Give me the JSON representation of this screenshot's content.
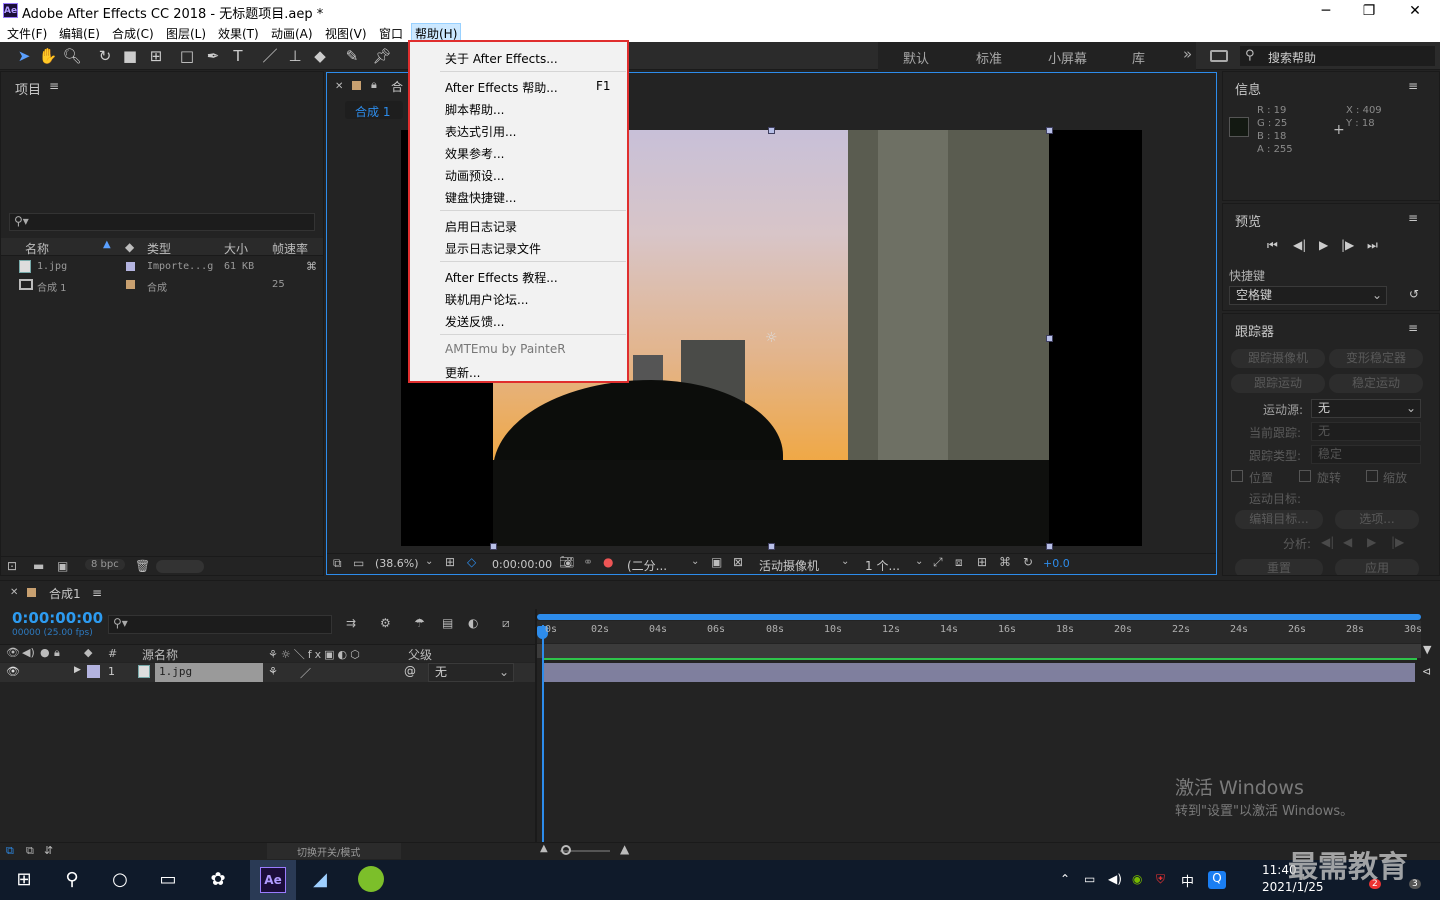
{
  "window": {
    "title": "Adobe After Effects CC 2018 - 无标题项目.aep *",
    "app_badge": "Ae",
    "minimize": "─",
    "maximize": "❐",
    "close": "✕"
  },
  "menubar": {
    "items": [
      "文件(F)",
      "编辑(E)",
      "合成(C)",
      "图层(L)",
      "效果(T)",
      "动画(A)",
      "视图(V)",
      "窗口",
      "帮助(H)"
    ]
  },
  "workspaces": {
    "items": [
      "默认",
      "标准",
      "小屏幕",
      "库"
    ],
    "more": "»",
    "search_placeholder": "搜索帮助"
  },
  "help_menu": {
    "items": [
      {
        "label": "关于 After Effects...",
        "shortcut": ""
      },
      {
        "label": "After Effects 帮助...",
        "shortcut": "F1"
      },
      {
        "label": "脚本帮助...",
        "shortcut": ""
      },
      {
        "label": "表达式引用...",
        "shortcut": ""
      },
      {
        "label": "效果参考...",
        "shortcut": ""
      },
      {
        "label": "动画预设...",
        "shortcut": ""
      },
      {
        "label": "键盘快捷键...",
        "shortcut": ""
      },
      {
        "label": "启用日志记录",
        "shortcut": ""
      },
      {
        "label": "显示日志记录文件",
        "shortcut": ""
      },
      {
        "label": "After Effects 教程...",
        "shortcut": ""
      },
      {
        "label": "联机用户论坛...",
        "shortcut": ""
      },
      {
        "label": "发送反馈...",
        "shortcut": ""
      },
      {
        "label": "AMTEmu by PainteR",
        "shortcut": ""
      },
      {
        "label": "更新...",
        "shortcut": ""
      }
    ]
  },
  "project_panel": {
    "title": "项目",
    "search_placeholder": "",
    "columns": [
      "名称",
      "类型",
      "大小",
      "帧速率"
    ],
    "rows": [
      {
        "name": "1.jpg",
        "type": "Importe...g",
        "size": "61 KB",
        "fps": ""
      },
      {
        "name": "合成 1",
        "type": "合成",
        "size": "",
        "fps": "25"
      }
    ],
    "bpc": "8 bpc"
  },
  "comp_viewer": {
    "tab_label": "合成 1",
    "tab_title": "合",
    "zoom": "(38.6%)",
    "timecode": "0:00:00:00",
    "resolution": "(二分...",
    "camera": "活动摄像机",
    "views": "1 个...",
    "exposure": "+0.0"
  },
  "info_panel": {
    "title": "信息",
    "r": "R : 19",
    "g": "G : 25",
    "b": "B : 18",
    "a": "A : 255",
    "x": "X : 409",
    "y": "Y : 18",
    "swatch_color": "#131912"
  },
  "preview_panel": {
    "title": "预览",
    "shortcut_label": "快捷键",
    "shortcut_value": "空格键"
  },
  "tracker_panel": {
    "title": "跟踪器",
    "btn_track_camera": "跟踪摄像机",
    "btn_warp": "变形稳定器",
    "btn_track_motion": "跟踪运动",
    "btn_stabilize": "稳定运动",
    "motion_source_label": "运动源:",
    "motion_source_value": "无",
    "current_track_label": "当前跟踪:",
    "current_track_value": "无",
    "track_type_label": "跟踪类型:",
    "track_type_value": "稳定",
    "cb_position": "位置",
    "cb_rotation": "旋转",
    "cb_scale": "缩放",
    "motion_target_label": "运动目标:",
    "edit_target": "编辑目标...",
    "options": "选项...",
    "analyze_label": "分析:",
    "reset": "重置",
    "apply": "应用"
  },
  "timeline": {
    "comp_tab": "合成1",
    "timecode": "0:00:00:00",
    "fps_info": "00000 (25.00 fps)",
    "col_num": "#",
    "col_source": "源名称",
    "col_parent": "父级",
    "layer": {
      "index": "1",
      "name": "1.jpg",
      "parent": "无"
    },
    "ticks": [
      "0s",
      "02s",
      "04s",
      "06s",
      "08s",
      "10s",
      "12s",
      "14s",
      "16s",
      "18s",
      "20s",
      "22s",
      "24s",
      "26s",
      "28s",
      "30s"
    ],
    "toggle_label": "切换开关/模式"
  },
  "watermark": {
    "line1": "激活 Windows",
    "line2": "转到\"设置\"以激活 Windows。",
    "brand": "最需教育"
  },
  "taskbar": {
    "time": "11:40",
    "date": "2021/1/25",
    "ime": "中",
    "badge1": "2",
    "badge2": "3"
  },
  "colors": {
    "accent": "#2d8ceb",
    "menu_highlight": "#e02e2e",
    "timecode": "#2d9bf0",
    "layer_label": "#b4b4e0"
  }
}
